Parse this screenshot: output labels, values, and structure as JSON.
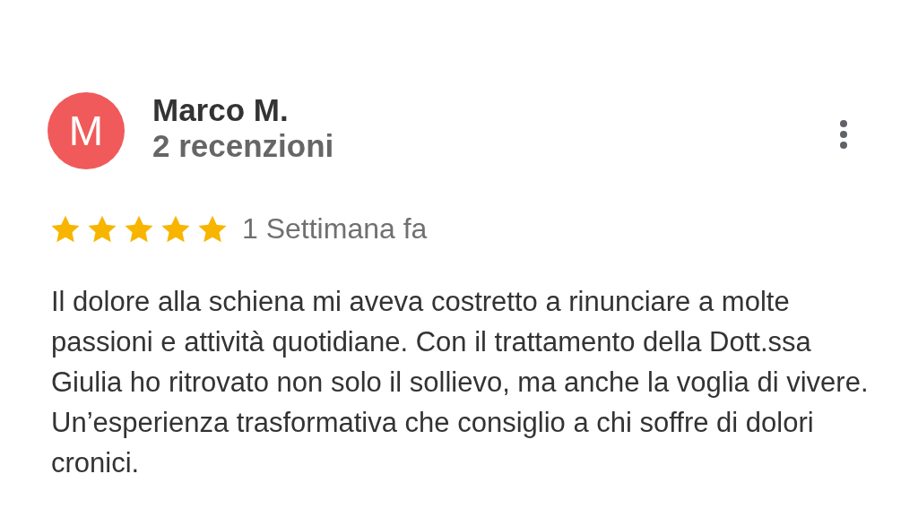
{
  "review": {
    "avatar_letter": "M",
    "author": "Marco M.",
    "review_count": "2 recenzioni",
    "stars": 5,
    "time": "1 Settimana fa",
    "text": "Il dolore alla schiena mi aveva costretto a rinunciare a molte passioni e attività quotidiane. Con il trattamento della Dott.ssa Giulia ho ritrovato non solo il sollievo, ma anche la voglia di vivere. Un’esperienza trasformativa che consiglio a chi soffre di dolori cronici."
  }
}
